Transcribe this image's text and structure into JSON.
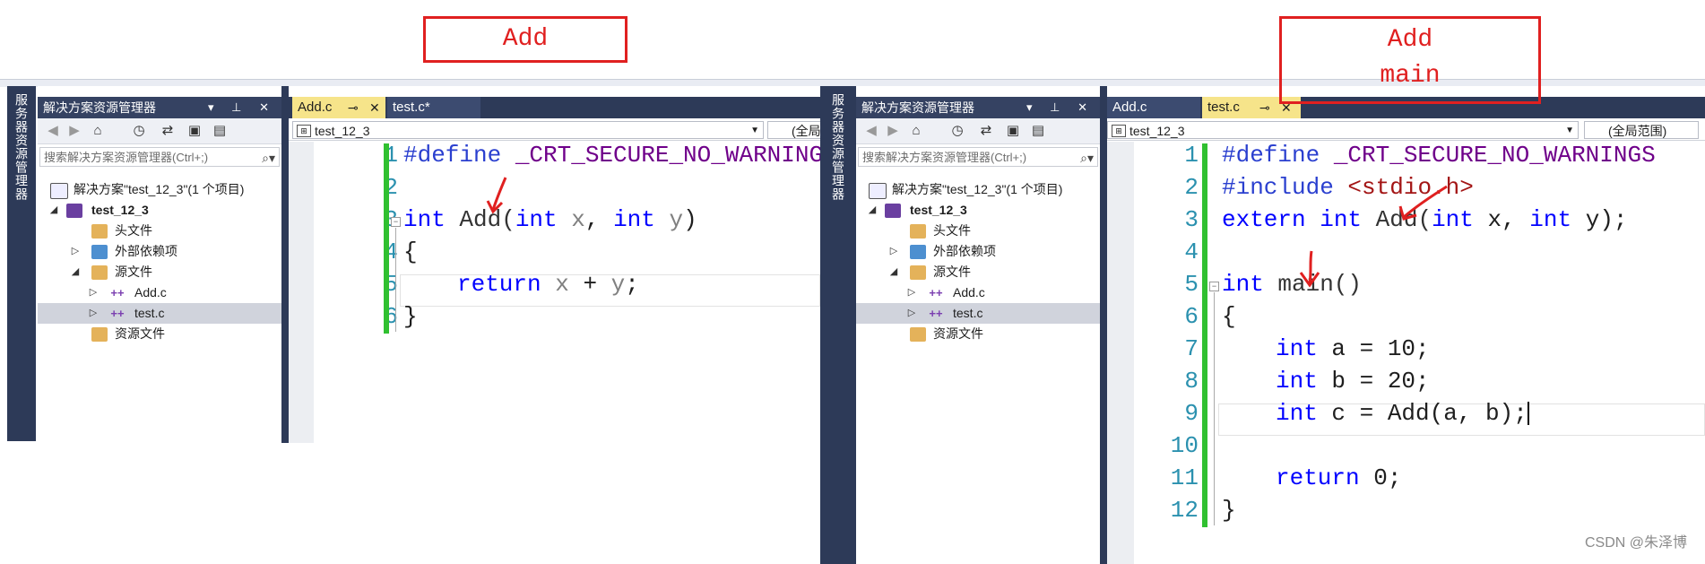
{
  "left": {
    "annotation": {
      "lines": [
        "Add"
      ]
    },
    "sidebar_label": "服务器资源管理器",
    "explorer": {
      "title": "解决方案资源管理器",
      "title_controls": "▾ ⊥ ✕",
      "search_placeholder": "搜索解决方案资源管理器(Ctrl+;)",
      "tree": [
        {
          "label": "解决方案\"test_12_3\"(1 个项目)"
        },
        {
          "label": "test_12_3"
        },
        {
          "label": "头文件"
        },
        {
          "label": "外部依赖项"
        },
        {
          "label": "源文件"
        },
        {
          "label": "Add.c"
        },
        {
          "label": "test.c"
        },
        {
          "label": "资源文件"
        }
      ]
    },
    "editor": {
      "tabs": [
        {
          "label": "Add.c"
        },
        {
          "label": "test.c*"
        }
      ],
      "nav_project": "test_12_3",
      "nav_scope": "(全局",
      "line_numbers": [
        "1",
        "2",
        "3",
        "4",
        "5",
        "6"
      ],
      "code": {
        "l1_pre": "#define",
        "l1_macro": " _CRT_SECURE_NO_WARNINGS",
        "l3_kw": "int",
        "l3_fn": " Add(",
        "l3_kw2": "int",
        "l3_p1": " x",
        "l3_sep": ", ",
        "l3_kw3": "int",
        "l3_p2": " y",
        "l3_end": ")",
        "l4": "{",
        "l5_kw": "return",
        "l5_p1": " x",
        "l5_op": " + ",
        "l5_p2": "y",
        "l5_end": ";",
        "l6": "}"
      }
    }
  },
  "right": {
    "annotation": {
      "lines": [
        "Add",
        "main"
      ]
    },
    "sidebar_label": "服务器资源管理器",
    "explorer": {
      "title": "解决方案资源管理器",
      "title_controls": "▾ ⊥ ✕",
      "search_placeholder": "搜索解决方案资源管理器(Ctrl+;)",
      "tree": [
        {
          "label": "解决方案\"test_12_3\"(1 个项目)"
        },
        {
          "label": "test_12_3"
        },
        {
          "label": "头文件"
        },
        {
          "label": "外部依赖项"
        },
        {
          "label": "源文件"
        },
        {
          "label": "Add.c"
        },
        {
          "label": "test.c"
        },
        {
          "label": "资源文件"
        }
      ]
    },
    "editor": {
      "tabs": [
        {
          "label": "Add.c"
        },
        {
          "label": "test.c"
        }
      ],
      "nav_project": "test_12_3",
      "nav_scope": "(全局范围)",
      "line_numbers": [
        "1",
        "2",
        "3",
        "4",
        "5",
        "6",
        "7",
        "8",
        "9",
        "10",
        "11",
        "12"
      ],
      "code": {
        "l1_pre": "#define",
        "l1_macro": " _CRT_SECURE_NO_WARNINGS",
        "l2_pre": "#include",
        "l2_inc": " <stdio.h>",
        "l3_kw": "extern",
        "l3_kw2": " int",
        "l3_fn": " Add(",
        "l3_kw3": "int",
        "l3_p1": " x, ",
        "l3_kw4": "int",
        "l3_p2": " y);",
        "l5_kw": "int",
        "l5_fn": " main()",
        "l6": "{",
        "l7_kw": "int",
        "l7_rest": " a = 10;",
        "l8_kw": "int",
        "l8_rest": " b = 20;",
        "l9_kw": "int",
        "l9_rest": " c = Add(a, b);",
        "l11_kw": "return",
        "l11_rest": " 0;",
        "l12": "}"
      }
    }
  },
  "watermark": "CSDN @朱泽博",
  "colors": {
    "annotation_red": "#e02020",
    "vs_dark": "#2d3a58",
    "tab_active": "#f6e48a",
    "change_bar": "#30c030"
  },
  "icons": [
    "search-icon",
    "back-icon",
    "forward-icon",
    "home-icon",
    "history-icon",
    "sync-icon",
    "collapse-icon",
    "properties-icon",
    "pin-icon",
    "close-icon",
    "folder-icon",
    "project-icon",
    "c-file-icon"
  ]
}
